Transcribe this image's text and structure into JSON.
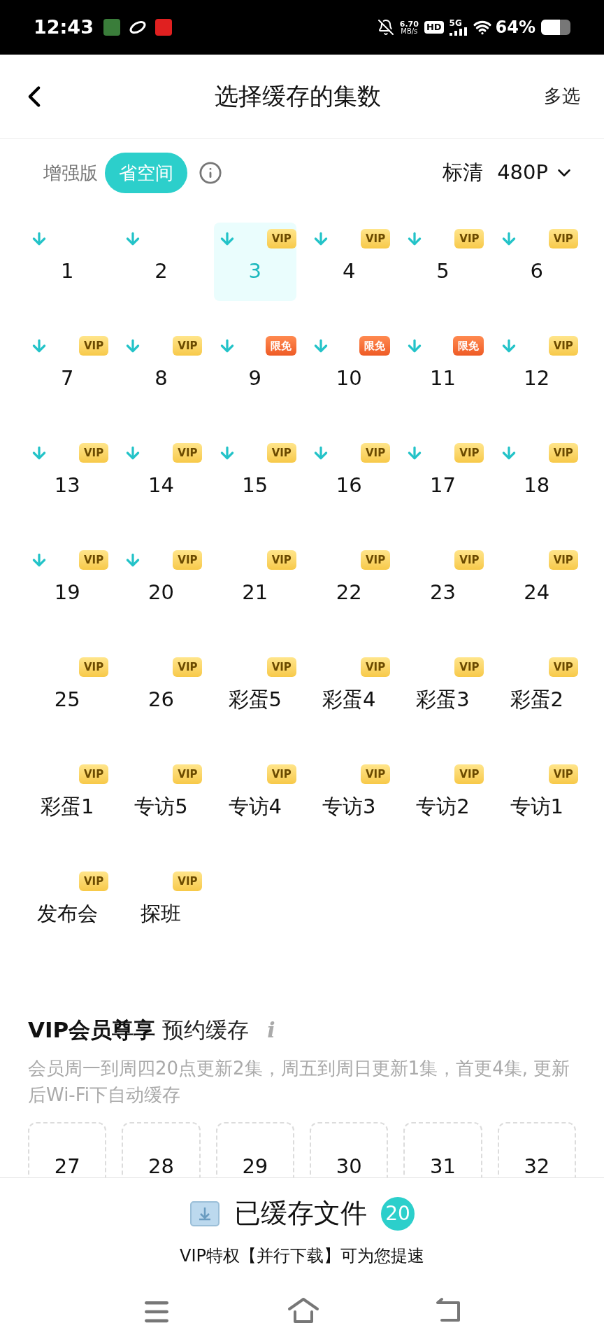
{
  "status_bar": {
    "time": "12:43",
    "speed": "6.70",
    "speed_unit": "MB/s",
    "hd": "HD",
    "network": "5G",
    "battery": "64%"
  },
  "header": {
    "title": "选择缓存的集数",
    "action": "多选"
  },
  "modes": [
    {
      "label": "增强版",
      "selected": false
    },
    {
      "label": "省空间",
      "selected": true
    }
  ],
  "quality": {
    "label": "标清",
    "value": "480P"
  },
  "episodes": [
    {
      "label": "1",
      "downloaded": true,
      "selected": false
    },
    {
      "label": "2",
      "downloaded": true,
      "selected": false
    },
    {
      "label": "3",
      "downloaded": true,
      "selected": true,
      "badge": {
        "kind": "vip",
        "text": "VIP"
      }
    },
    {
      "label": "4",
      "downloaded": true,
      "selected": false,
      "badge": {
        "kind": "vip",
        "text": "VIP"
      }
    },
    {
      "label": "5",
      "downloaded": true,
      "selected": false,
      "badge": {
        "kind": "vip",
        "text": "VIP"
      }
    },
    {
      "label": "6",
      "downloaded": true,
      "selected": false,
      "badge": {
        "kind": "vip",
        "text": "VIP"
      }
    },
    {
      "label": "7",
      "downloaded": true,
      "selected": false,
      "badge": {
        "kind": "vip",
        "text": "VIP"
      }
    },
    {
      "label": "8",
      "downloaded": true,
      "selected": false,
      "badge": {
        "kind": "vip",
        "text": "VIP"
      }
    },
    {
      "label": "9",
      "downloaded": true,
      "selected": false,
      "badge": {
        "kind": "free",
        "text": "限免"
      }
    },
    {
      "label": "10",
      "downloaded": true,
      "selected": false,
      "badge": {
        "kind": "free",
        "text": "限免"
      }
    },
    {
      "label": "11",
      "downloaded": true,
      "selected": false,
      "badge": {
        "kind": "free",
        "text": "限免"
      }
    },
    {
      "label": "12",
      "downloaded": true,
      "selected": false,
      "badge": {
        "kind": "vip",
        "text": "VIP"
      }
    },
    {
      "label": "13",
      "downloaded": true,
      "selected": false,
      "badge": {
        "kind": "vip",
        "text": "VIP"
      }
    },
    {
      "label": "14",
      "downloaded": true,
      "selected": false,
      "badge": {
        "kind": "vip",
        "text": "VIP"
      }
    },
    {
      "label": "15",
      "downloaded": true,
      "selected": false,
      "badge": {
        "kind": "vip",
        "text": "VIP"
      }
    },
    {
      "label": "16",
      "downloaded": true,
      "selected": false,
      "badge": {
        "kind": "vip",
        "text": "VIP"
      }
    },
    {
      "label": "17",
      "downloaded": true,
      "selected": false,
      "badge": {
        "kind": "vip",
        "text": "VIP"
      }
    },
    {
      "label": "18",
      "downloaded": true,
      "selected": false,
      "badge": {
        "kind": "vip",
        "text": "VIP"
      }
    },
    {
      "label": "19",
      "downloaded": true,
      "selected": false,
      "badge": {
        "kind": "vip",
        "text": "VIP"
      }
    },
    {
      "label": "20",
      "downloaded": true,
      "selected": false,
      "badge": {
        "kind": "vip",
        "text": "VIP"
      }
    },
    {
      "label": "21",
      "downloaded": false,
      "selected": false,
      "badge": {
        "kind": "vip",
        "text": "VIP"
      }
    },
    {
      "label": "22",
      "downloaded": false,
      "selected": false,
      "badge": {
        "kind": "vip",
        "text": "VIP"
      }
    },
    {
      "label": "23",
      "downloaded": false,
      "selected": false,
      "badge": {
        "kind": "vip",
        "text": "VIP"
      }
    },
    {
      "label": "24",
      "downloaded": false,
      "selected": false,
      "badge": {
        "kind": "vip",
        "text": "VIP"
      }
    },
    {
      "label": "25",
      "downloaded": false,
      "selected": false,
      "badge": {
        "kind": "vip",
        "text": "VIP"
      }
    },
    {
      "label": "26",
      "downloaded": false,
      "selected": false,
      "badge": {
        "kind": "vip",
        "text": "VIP"
      }
    },
    {
      "label": "彩蛋5",
      "downloaded": false,
      "selected": false,
      "badge": {
        "kind": "vip",
        "text": "VIP"
      }
    },
    {
      "label": "彩蛋4",
      "downloaded": false,
      "selected": false,
      "badge": {
        "kind": "vip",
        "text": "VIP"
      }
    },
    {
      "label": "彩蛋3",
      "downloaded": false,
      "selected": false,
      "badge": {
        "kind": "vip",
        "text": "VIP"
      }
    },
    {
      "label": "彩蛋2",
      "downloaded": false,
      "selected": false,
      "badge": {
        "kind": "vip",
        "text": "VIP"
      }
    },
    {
      "label": "彩蛋1",
      "downloaded": false,
      "selected": false,
      "badge": {
        "kind": "vip",
        "text": "VIP"
      }
    },
    {
      "label": "专访5",
      "downloaded": false,
      "selected": false,
      "badge": {
        "kind": "vip",
        "text": "VIP"
      }
    },
    {
      "label": "专访4",
      "downloaded": false,
      "selected": false,
      "badge": {
        "kind": "vip",
        "text": "VIP"
      }
    },
    {
      "label": "专访3",
      "downloaded": false,
      "selected": false,
      "badge": {
        "kind": "vip",
        "text": "VIP"
      }
    },
    {
      "label": "专访2",
      "downloaded": false,
      "selected": false,
      "badge": {
        "kind": "vip",
        "text": "VIP"
      }
    },
    {
      "label": "专访1",
      "downloaded": false,
      "selected": false,
      "badge": {
        "kind": "vip",
        "text": "VIP"
      }
    },
    {
      "label": "发布会",
      "downloaded": false,
      "selected": false,
      "badge": {
        "kind": "vip",
        "text": "VIP"
      }
    },
    {
      "label": "探班",
      "downloaded": false,
      "selected": false,
      "badge": {
        "kind": "vip",
        "text": "VIP"
      }
    }
  ],
  "reservation": {
    "title_bold": "VIP会员尊享",
    "title": "预约缓存",
    "info": "i",
    "description": "会员周一到周四20点更新2集，周五到周日更新1集，首更4集, 更新后Wi-Fi下自动缓存",
    "episodes": [
      "27",
      "28",
      "29",
      "30",
      "31",
      "32"
    ]
  },
  "footer": {
    "label": "已缓存文件",
    "count": "20",
    "subtitle": "VIP特权【并行下载】可为您提速"
  }
}
